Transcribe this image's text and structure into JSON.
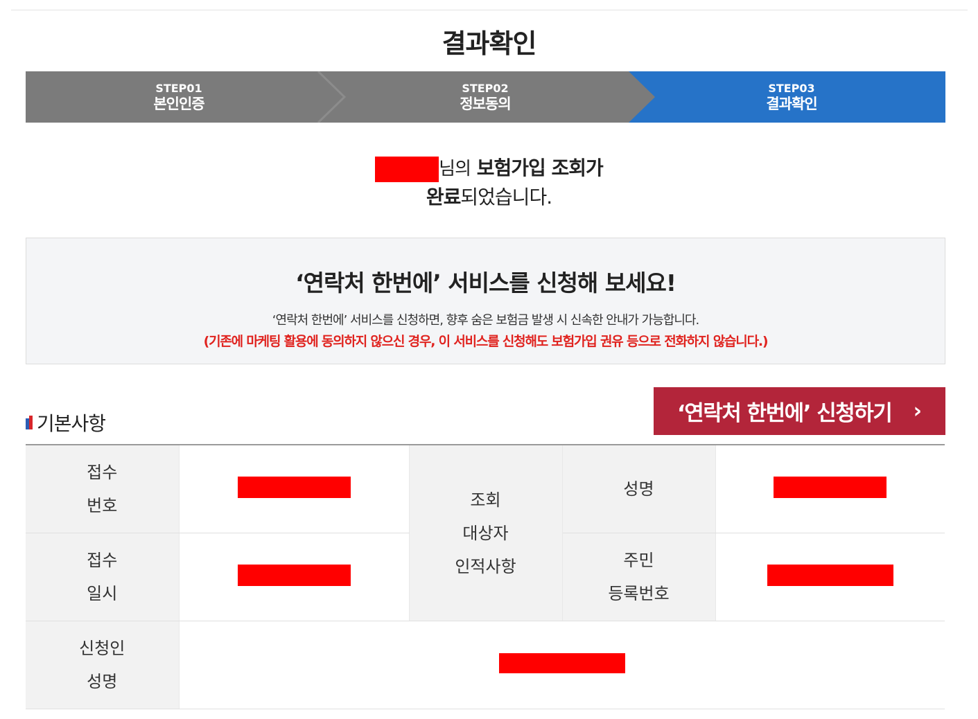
{
  "page": {
    "title": "결과확인"
  },
  "steps": [
    {
      "num": "STEP01",
      "label": "본인인증",
      "active": false
    },
    {
      "num": "STEP02",
      "label": "정보동의",
      "active": false
    },
    {
      "num": "STEP03",
      "label": "결과확인",
      "active": true
    }
  ],
  "colors": {
    "step_inactive": "#7b7b7b",
    "step_active": "#2673c8",
    "apply_button": "#b3253a",
    "notice": "#e0231f",
    "redaction": "#ff0000"
  },
  "result": {
    "suffix": "님의",
    "line1_rest": "보험가입 조회가",
    "line2_bold": "완료",
    "line2_rest": "되었습니다."
  },
  "promo": {
    "title": "‘연락처 한번에’ 서비스를 신청해 보세요!",
    "desc": "‘연락처 한번에’ 서비스를 신청하면, 향후 숨은 보험금 발생 시 신속한 안내가 가능합니다.",
    "notice": "(기존에 마케팅 활용에 동의하지 않으신 경우, 이 서비스를 신청해도 보험가입 권유 등으로 전화하지 않습니다.)"
  },
  "section": {
    "title": "기본사항"
  },
  "apply_button": {
    "label": "‘연락처 한번에’ 신청하기",
    "arrow": "›"
  },
  "table": {
    "receipt_no_label_1": "접수",
    "receipt_no_label_2": "번호",
    "receipt_dt_label_1": "접수",
    "receipt_dt_label_2": "일시",
    "target_label_1": "조회",
    "target_label_2": "대상자",
    "target_label_3": "인적사항",
    "name_label": "성명",
    "rrn_label_1": "주민",
    "rrn_label_2": "등록번호",
    "applicant_label_1": "신청인",
    "applicant_label_2": "성명"
  }
}
